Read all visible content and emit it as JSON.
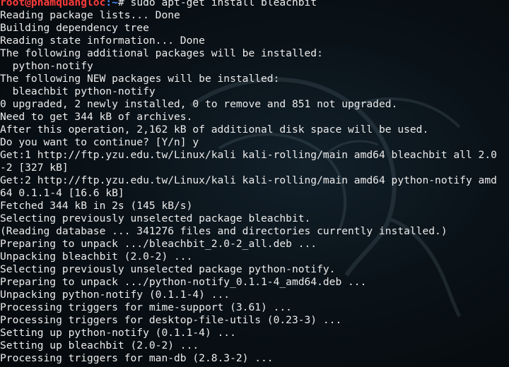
{
  "colors": {
    "background": "#000000",
    "text": "#ececec",
    "prompt_user": "#ff3b3b",
    "prompt_path": "#4a8cff"
  },
  "watermark_icon": "kali-dragon-icon",
  "prompt": {
    "user_host": "root@phamquangloc",
    "path": ":~",
    "symbol": "# ",
    "command": "sudo apt-get install bleachbit"
  },
  "output": [
    "Reading package lists... Done",
    "Building dependency tree",
    "Reading state information... Done",
    "The following additional packages will be installed:",
    "  python-notify",
    "The following NEW packages will be installed:",
    "  bleachbit python-notify",
    "0 upgraded, 2 newly installed, 0 to remove and 851 not upgraded.",
    "Need to get 344 kB of archives.",
    "After this operation, 2,162 kB of additional disk space will be used.",
    "Do you want to continue? [Y/n] y",
    "Get:1 http://ftp.yzu.edu.tw/Linux/kali kali-rolling/main amd64 bleachbit all 2.0",
    "-2 [327 kB]",
    "Get:2 http://ftp.yzu.edu.tw/Linux/kali kali-rolling/main amd64 python-notify amd",
    "64 0.1.1-4 [16.6 kB]",
    "Fetched 344 kB in 2s (145 kB/s)",
    "Selecting previously unselected package bleachbit.",
    "(Reading database ... 341276 files and directories currently installed.)",
    "Preparing to unpack .../bleachbit_2.0-2_all.deb ...",
    "Unpacking bleachbit (2.0-2) ...",
    "Selecting previously unselected package python-notify.",
    "Preparing to unpack .../python-notify_0.1.1-4_amd64.deb ...",
    "Unpacking python-notify (0.1.1-4) ...",
    "Processing triggers for mime-support (3.61) ...",
    "Processing triggers for desktop-file-utils (0.23-3) ...",
    "Setting up python-notify (0.1.1-4) ...",
    "Setting up bleachbit (2.0-2) ...",
    "Processing triggers for man-db (2.8.3-2) ..."
  ]
}
